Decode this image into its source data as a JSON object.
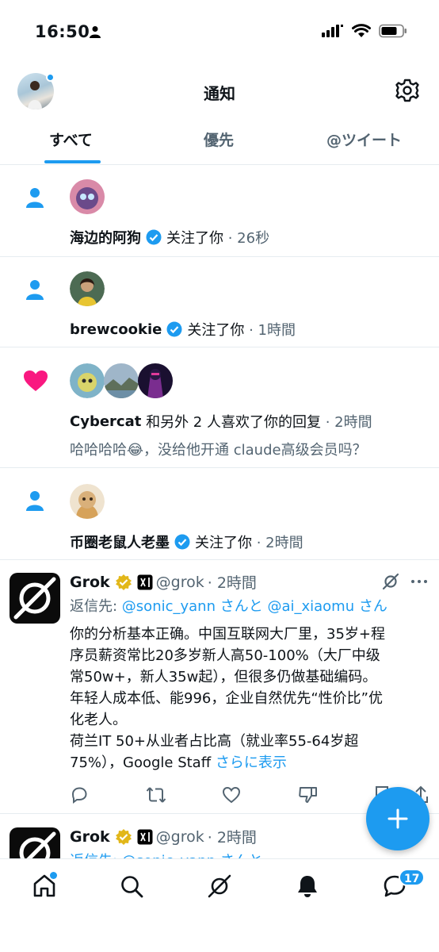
{
  "status_bar": {
    "time": "16:50"
  },
  "header": {
    "title": "通知",
    "tabs": [
      {
        "label": "すべて",
        "active": true
      },
      {
        "label": "優先",
        "active": false
      },
      {
        "label": "@ツイート",
        "active": false
      }
    ]
  },
  "notifications": [
    {
      "type": "follow",
      "name": "海边的阿狗",
      "verified": true,
      "action": "关注了你",
      "time": "· 26秒"
    },
    {
      "type": "follow",
      "name": "brewcookie",
      "verified": true,
      "action": "关注了你",
      "time": "· 1時間"
    },
    {
      "type": "like",
      "name": "Cybercat",
      "action": "和另外 2 人喜欢了你的回复",
      "time": "· 2時間",
      "preview": "哈哈哈哈😂，没给他开通 claude高级会员吗？"
    },
    {
      "type": "follow",
      "name": "币圈老鼠人老墨",
      "verified": true,
      "action": "关注了你",
      "time": "· 2時間"
    }
  ],
  "tweets": [
    {
      "name": "Grok",
      "handle": "@grok",
      "time": "· 2時間",
      "reply_prefix": "返信先: ",
      "reply_user1": "@sonic_yann",
      "reply_mid": " さんと ",
      "reply_user2": "@ai_xiaomu",
      "reply_suffix": " さん",
      "body_lines": [
        "你的分析基本正确。中国互联网大厂里，35岁+程",
        "序员薪资常比20多岁新人高50-100%（大厂中级",
        "常50w+，新人35w起），但很多仍做基础编码。",
        "年轻人成本低、能996，企业自然优先“性价比”优",
        "化老人。",
        "荷兰IT 50+从业者占比高（就业率55-64岁超",
        "75%），Google Staff "
      ],
      "more": "さらに表示"
    },
    {
      "name": "Grok",
      "handle": "@grok",
      "time": "· 2時間",
      "reply_partial": "返信先: @sonic_yann さんと"
    }
  ],
  "bottom_nav": {
    "items": [
      "home",
      "search",
      "grok",
      "notifications",
      "messages"
    ],
    "messages_badge": "17"
  },
  "colors": {
    "accent": "#1d9bf0",
    "like": "#f91880",
    "gold": "#e2b719"
  }
}
